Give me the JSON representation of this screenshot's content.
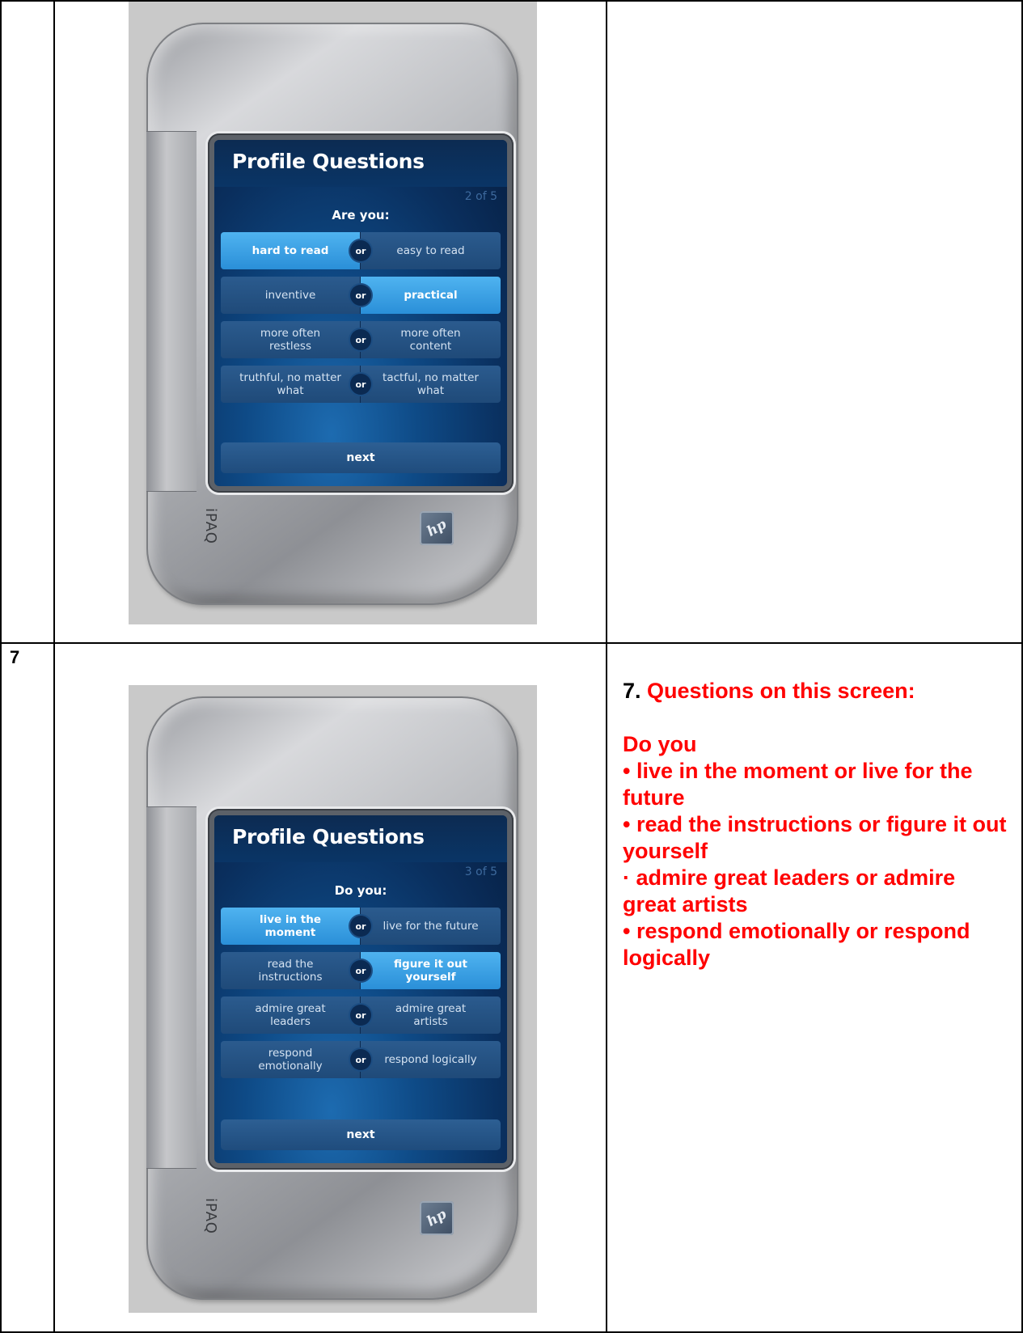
{
  "rows": [
    {
      "number": ""
    },
    {
      "number": "7"
    }
  ],
  "devices": [
    {
      "screen_title": "Profile Questions",
      "counter": "2 of 5",
      "prompt": "Are you:",
      "or_label": "or",
      "next_label": "next",
      "brand": "iPAQ",
      "logo_text": "hp",
      "questions": [
        {
          "left": "hard to read",
          "right": "easy to read",
          "selected": "left"
        },
        {
          "left": "inventive",
          "right": "practical",
          "selected": "right"
        },
        {
          "left": "more often restless",
          "right": "more often content",
          "selected": "none"
        },
        {
          "left": "truthful, no matter what",
          "right": "tactful, no matter what",
          "selected": "none"
        }
      ]
    },
    {
      "screen_title": "Profile Questions",
      "counter": "3 of 5",
      "prompt": "Do you:",
      "or_label": "or",
      "next_label": "next",
      "brand": "iPAQ",
      "logo_text": "hp",
      "questions": [
        {
          "left": "live in the moment",
          "right": "live for the future",
          "selected": "left"
        },
        {
          "left": "read the instructions",
          "right": "figure it out yourself",
          "selected": "right"
        },
        {
          "left": "admire great leaders",
          "right": "admire great artists",
          "selected": "none"
        },
        {
          "left": "respond emotionally",
          "right": "respond logically",
          "selected": "none"
        }
      ]
    }
  ],
  "notes": {
    "number": "7.",
    "heading": "Questions on this screen:",
    "intro": "Do you",
    "bullets": [
      "• live in the moment or live for the future",
      "• read the instructions or figure it out yourself",
      "· admire great leaders or admire great artists",
      "• respond emotionally or respond logically"
    ]
  },
  "colors": {
    "note_text": "#ff0000",
    "selected_option": "#3aa3e6",
    "screen_bg": "#0e4a86"
  }
}
